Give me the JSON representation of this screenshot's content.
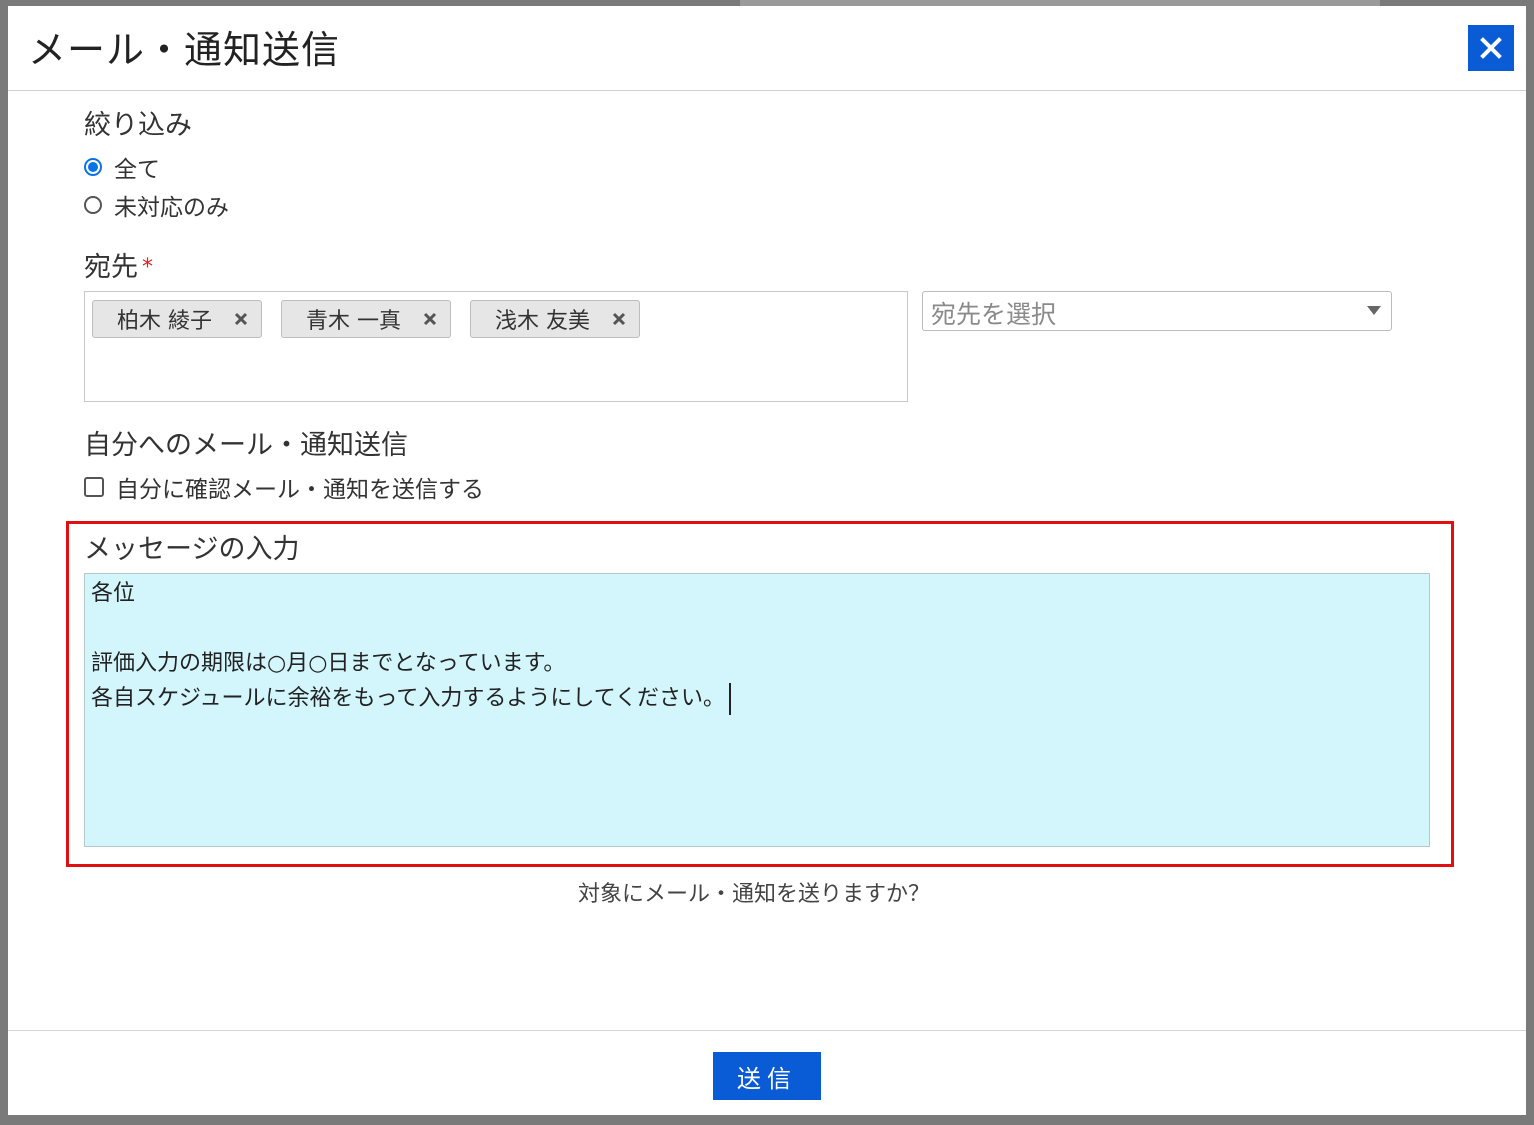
{
  "modal": {
    "title": "メール・通知送信"
  },
  "filter": {
    "label": "絞り込み",
    "options": [
      {
        "label": "全て",
        "selected": true
      },
      {
        "label": "未対応のみ",
        "selected": false
      }
    ]
  },
  "recipients": {
    "label": "宛先",
    "required_mark": "*",
    "chips": [
      "柏木 綾子",
      "青木 一真",
      "浅木 友美"
    ],
    "select_placeholder": "宛先を選択"
  },
  "self_notify": {
    "label": "自分へのメール・通知送信",
    "checkbox_label": "自分に確認メール・通知を送信する",
    "checked": false
  },
  "message": {
    "label": "メッセージの入力",
    "value": "各位\n\n評価入力の期限は○月○日までとなっています。\n各自スケジュールに余裕をもって入力するようにしてください。"
  },
  "confirm_text": "対象にメール・通知を送りますか？",
  "footer": {
    "send_label": "送信"
  },
  "colors": {
    "primary": "#0a5bd6",
    "highlight": "#e01010",
    "textarea_bg": "#d3f5fc"
  }
}
